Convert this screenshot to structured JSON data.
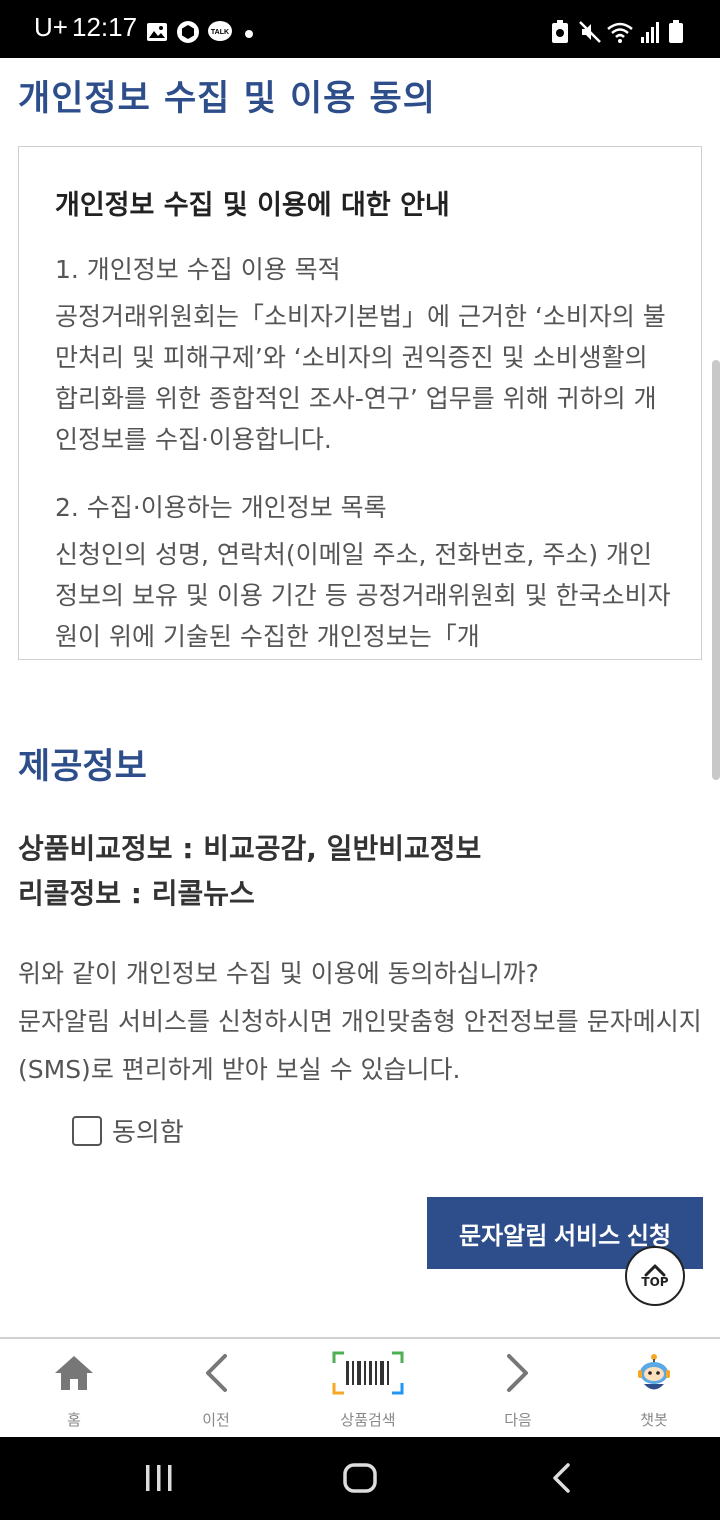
{
  "status_bar": {
    "carrier": "U+",
    "time": "12:17"
  },
  "page": {
    "title": "개인정보 수집 및 이용 동의",
    "terms": {
      "heading": "개인정보 수집 및 이용에 대한 안내",
      "section1_title": "1. 개인정보 수집 이용 목적",
      "section1_body": "공정거래위원회는「소비자기본법」에 근거한 ‘소비자의 불만처리 및 피해구제’와 ‘소비자의 권익증진 및 소비생활의 합리화를 위한 종합적인 조사-연구’ 업무를 위해 귀하의 개인정보를 수집·이용합니다.",
      "section2_title": "2. 수집·이용하는 개인정보 목록",
      "section2_body": "신청인의 성명, 연락처(이메일 주소, 전화번호, 주소) 개인정보의 보유 및 이용 기간 등 공정거래위원회 및 한국소비자원이 위에 기술된 수집한 개인정보는「개"
    },
    "provided_title": "제공정보",
    "provided_line1": "상품비교정보 : 비교공감, 일반비교정보",
    "provided_line2": "리콜정보 : 리콜뉴스",
    "consent_line1": "위와 같이 개인정보 수집 및 이용에 동의하십니까?",
    "consent_line2": "문자알림 서비스를 신청하시면 개인맞춤형 안전정보를 문자메시지(SMS)로 편리하게 받아 보실 수 있습니다.",
    "agree_label": "동의함",
    "sms_button_label": "문자알림 서비스 신청",
    "top_button_label": "TOP"
  },
  "bottom_nav": {
    "items": [
      {
        "label": "홈",
        "icon": "home-icon"
      },
      {
        "label": "이전",
        "icon": "chevron-left-icon"
      },
      {
        "label": "상품검색",
        "icon": "barcode-icon"
      },
      {
        "label": "다음",
        "icon": "chevron-right-icon"
      },
      {
        "label": "챗봇",
        "icon": "chatbot-icon"
      }
    ]
  },
  "colors": {
    "brand": "#2d4e8a",
    "text": "#555555"
  }
}
